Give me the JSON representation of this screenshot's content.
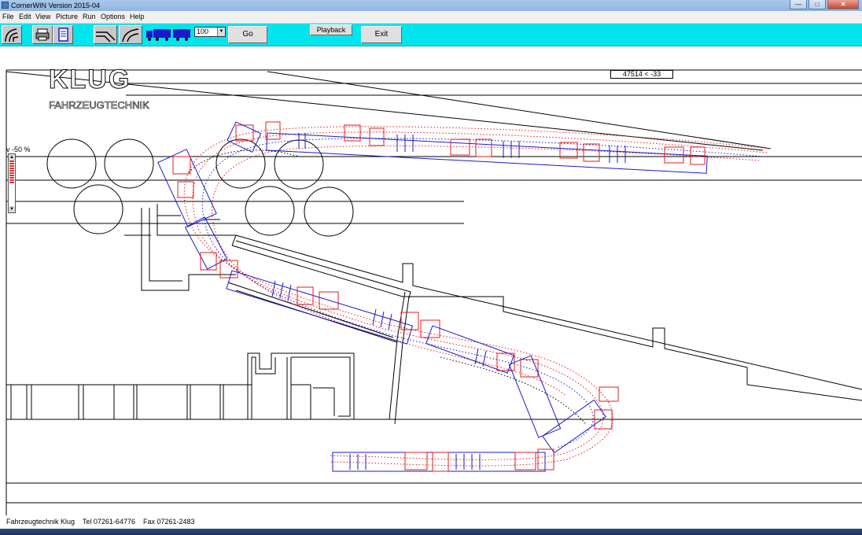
{
  "window": {
    "title": "CornerWIN  Version 2015-04"
  },
  "menu": {
    "items": [
      "File",
      "Edit",
      "View",
      "Picture",
      "Run",
      "Options",
      "Help"
    ]
  },
  "toolbar": {
    "zoom_value": "100",
    "go_label": "Go",
    "playback_label": "Playback",
    "exit_label": "Exit",
    "icons": [
      "corner-tool-icon",
      "print-icon",
      "document-icon",
      "curve-path-icon",
      "vehicle-icon"
    ]
  },
  "canvas": {
    "readout": "47514 < -33",
    "logo_top": "KLUG",
    "logo_bottom": "FAHRZEUGTECHNIK",
    "speed_label": "v -50 %",
    "speed_fraction": 0.5
  },
  "footer": {
    "company": "Fahrzeugtechnik Klug",
    "phone": "Tel 07261-64776",
    "fax": "Fax 07261-2483"
  },
  "colors": {
    "toolbar_bg": "#00e5ee",
    "vehicle_red": "#e81818",
    "vehicle_blue": "#1a1acc",
    "line": "#000000"
  }
}
